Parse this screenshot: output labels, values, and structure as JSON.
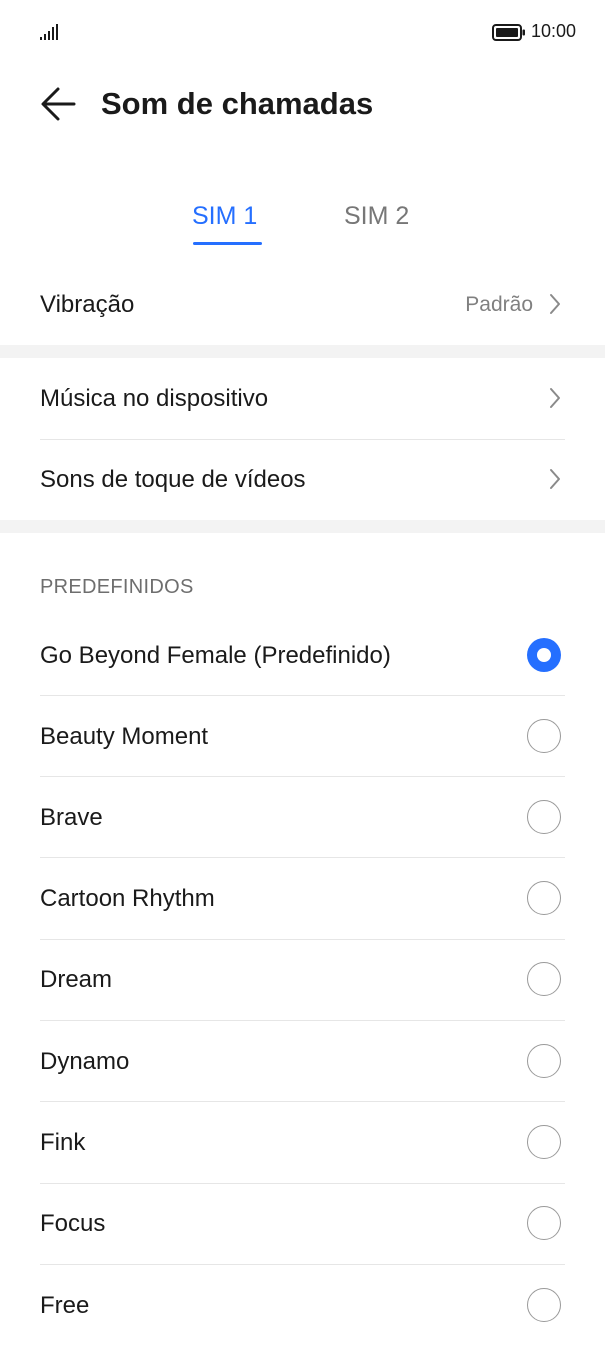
{
  "status_bar": {
    "time": "10:00",
    "signal_icon": "signal-icon",
    "battery_icon": "battery-icon"
  },
  "header": {
    "title": "Som de chamadas",
    "back_icon": "arrow-left-icon"
  },
  "tabs": [
    {
      "label": "SIM 1",
      "selected": true
    },
    {
      "label": "SIM 2",
      "selected": false
    }
  ],
  "vibration": {
    "label": "Vibração",
    "value": "Padrão"
  },
  "sources": [
    {
      "label": "Música no dispositivo"
    },
    {
      "label": "Sons de toque de vídeos"
    }
  ],
  "presets": {
    "header": "PREDEFINIDOS",
    "items": [
      {
        "label": "Go Beyond Female (Predefinido)",
        "selected": true
      },
      {
        "label": "Beauty Moment",
        "selected": false
      },
      {
        "label": "Brave",
        "selected": false
      },
      {
        "label": "Cartoon Rhythm",
        "selected": false
      },
      {
        "label": "Dream",
        "selected": false
      },
      {
        "label": "Dynamo",
        "selected": false
      },
      {
        "label": "Fink",
        "selected": false
      },
      {
        "label": "Focus",
        "selected": false
      },
      {
        "label": "Free",
        "selected": false
      }
    ]
  },
  "colors": {
    "accent": "#256fff",
    "text": "#1a1a1a",
    "secondary": "#808080",
    "divider": "#e6e6e6"
  }
}
